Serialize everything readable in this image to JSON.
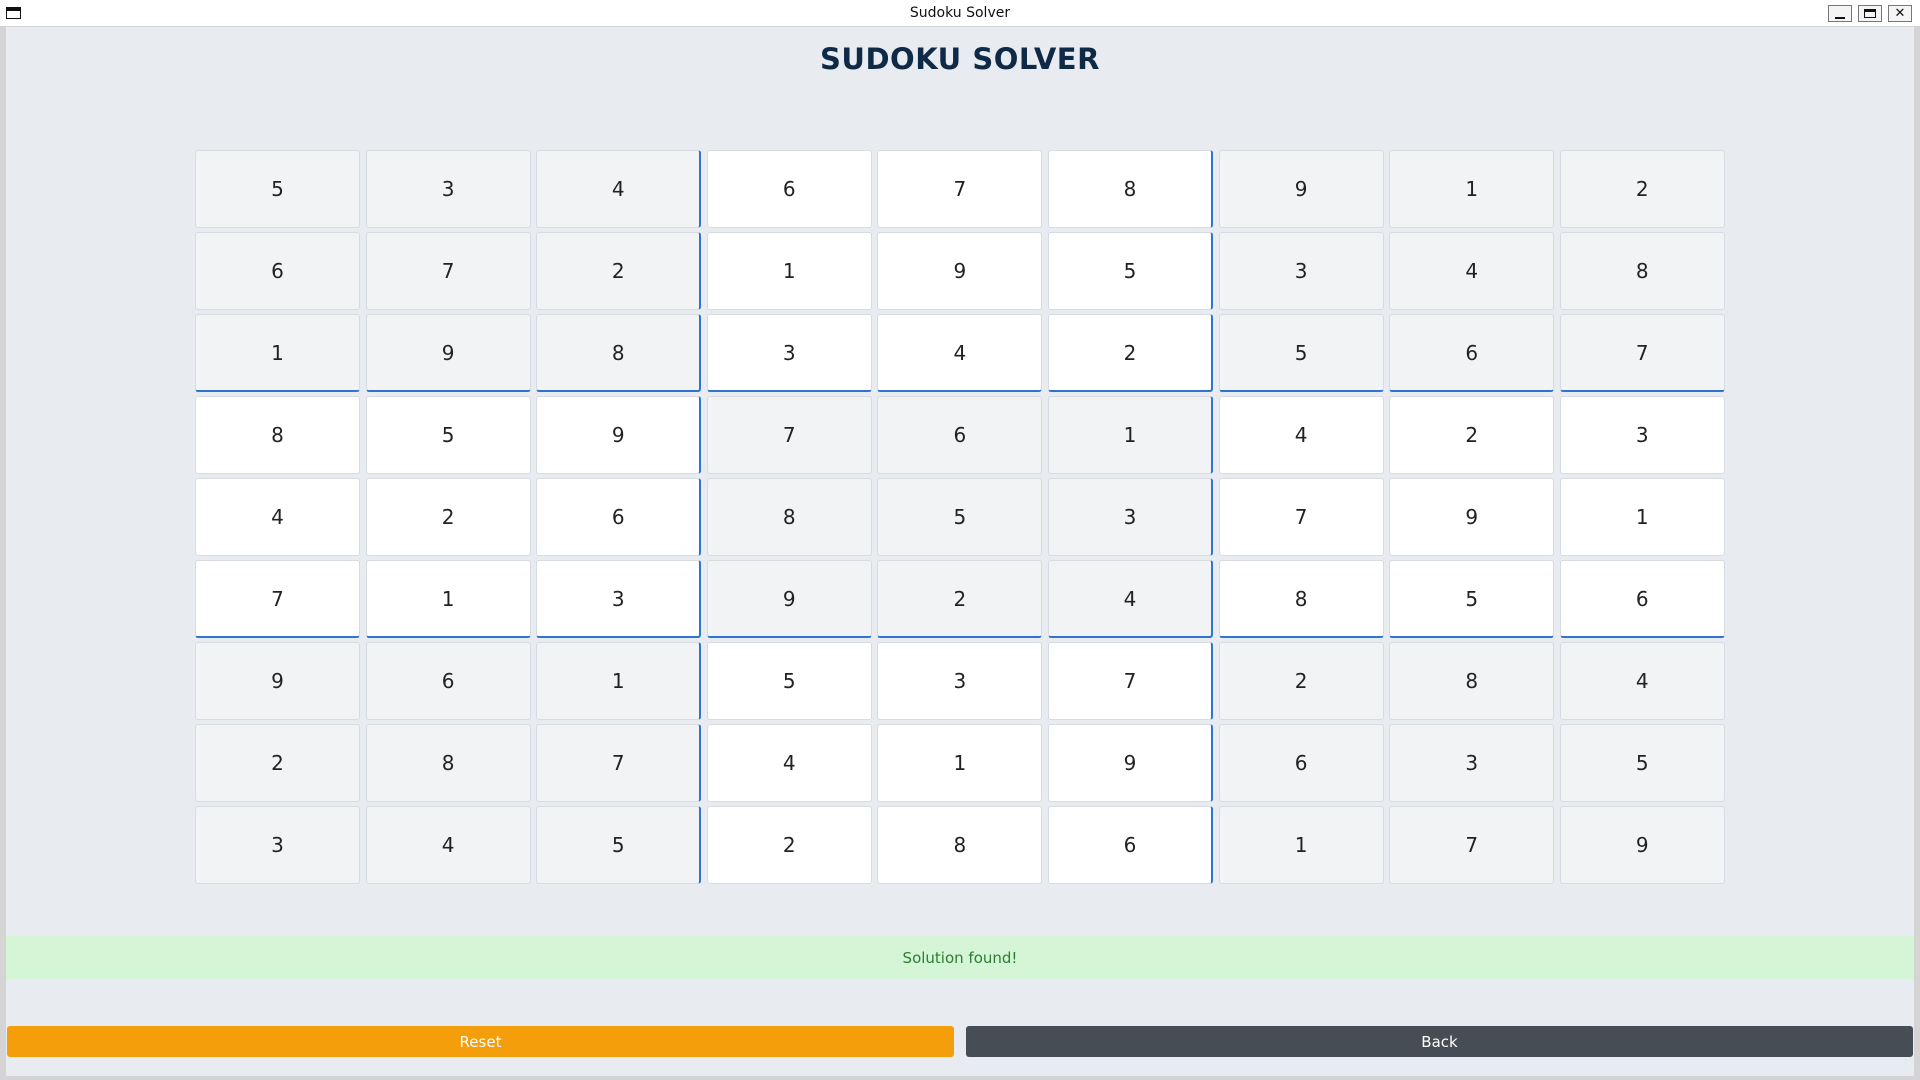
{
  "window": {
    "title": "Sudoku Solver",
    "controls": {
      "minimize": "minimize-icon",
      "maximize": "maximize-icon",
      "close": "✕"
    }
  },
  "heading": "SUDOKU SOLVER",
  "grid": [
    [
      "5",
      "3",
      "4",
      "6",
      "7",
      "8",
      "9",
      "1",
      "2"
    ],
    [
      "6",
      "7",
      "2",
      "1",
      "9",
      "5",
      "3",
      "4",
      "8"
    ],
    [
      "1",
      "9",
      "8",
      "3",
      "4",
      "2",
      "5",
      "6",
      "7"
    ],
    [
      "8",
      "5",
      "9",
      "7",
      "6",
      "1",
      "4",
      "2",
      "3"
    ],
    [
      "4",
      "2",
      "6",
      "8",
      "5",
      "3",
      "7",
      "9",
      "1"
    ],
    [
      "7",
      "1",
      "3",
      "9",
      "2",
      "4",
      "8",
      "5",
      "6"
    ],
    [
      "9",
      "6",
      "1",
      "5",
      "3",
      "7",
      "2",
      "8",
      "4"
    ],
    [
      "2",
      "8",
      "7",
      "4",
      "1",
      "9",
      "6",
      "3",
      "5"
    ],
    [
      "3",
      "4",
      "5",
      "2",
      "8",
      "6",
      "1",
      "7",
      "9"
    ]
  ],
  "status": {
    "text": "Solution found!",
    "color": "#2e7d32",
    "background": "#d4f5d6"
  },
  "buttons": {
    "reset_label": "Reset",
    "back_label": "Back",
    "reset_color": "#f59e0b",
    "back_color": "#474d55"
  },
  "colors": {
    "box_border": "#2f74d0",
    "cell_alt": "#f2f3f5",
    "cell_white": "#ffffff",
    "heading": "#0e2a47"
  }
}
